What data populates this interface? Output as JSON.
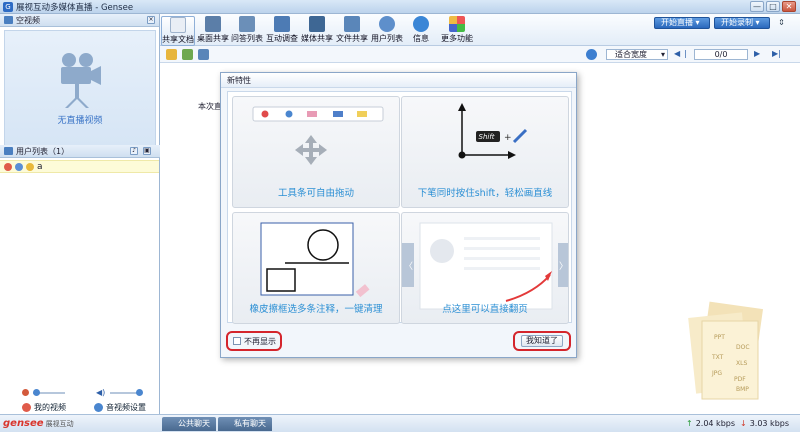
{
  "window": {
    "title": "展视互动多媒体直播 - Gensee",
    "min": "—",
    "max": "□",
    "close": "✕"
  },
  "left": {
    "video_header": "空视频",
    "video_placeholder": "无直播视频",
    "userlist_header": "用户列表（1）",
    "user_name": "a",
    "my_video": "我的视频",
    "av_settings": "音视频设置"
  },
  "toolbar": {
    "items": [
      {
        "label": "共享文档",
        "icon": "document-icon"
      },
      {
        "label": "桌面共享",
        "icon": "desktop-icon"
      },
      {
        "label": "问答列表",
        "icon": "qa-icon"
      },
      {
        "label": "互动调查",
        "icon": "survey-icon"
      },
      {
        "label": "媒体共享",
        "icon": "media-icon"
      },
      {
        "label": "文件共享",
        "icon": "file-share-icon"
      },
      {
        "label": "用户列表",
        "icon": "users-icon"
      },
      {
        "label": "信息",
        "icon": "info-icon"
      },
      {
        "label": "更多功能",
        "icon": "more-icon"
      }
    ],
    "start_live": "开始直播 ▾",
    "start_record": "开始录制 ▾"
  },
  "docbar": {
    "zoom": "适合宽度",
    "page": "0/0"
  },
  "content": {
    "snippet": "本次直"
  },
  "dialog": {
    "title": "新特性",
    "card1": "工具条可自由拖动",
    "card2": "下笔同时按住shift，轻松画直线",
    "card3": "橡皮擦框选多条注释，一键清理",
    "card4": "点这里可以直接翻页",
    "shift_key": "Shift",
    "plus": "+",
    "dont_show": "不再显示",
    "ok": "我知道了"
  },
  "file_labels": [
    "PPT",
    "DOC",
    "TXT",
    "XLS",
    "JPG",
    "PDF",
    "BMP"
  ],
  "status": {
    "brand_main": "gensee",
    "brand_sub": "展视互动",
    "public_chat": "公共聊天",
    "private_chat": "私有聊天",
    "upload": "2.04 kbps",
    "download": "3.03 kbps"
  },
  "colors": {
    "accent": "#2b8fd4",
    "highlight": "#d4252c",
    "start_button": "#2a68bc"
  }
}
